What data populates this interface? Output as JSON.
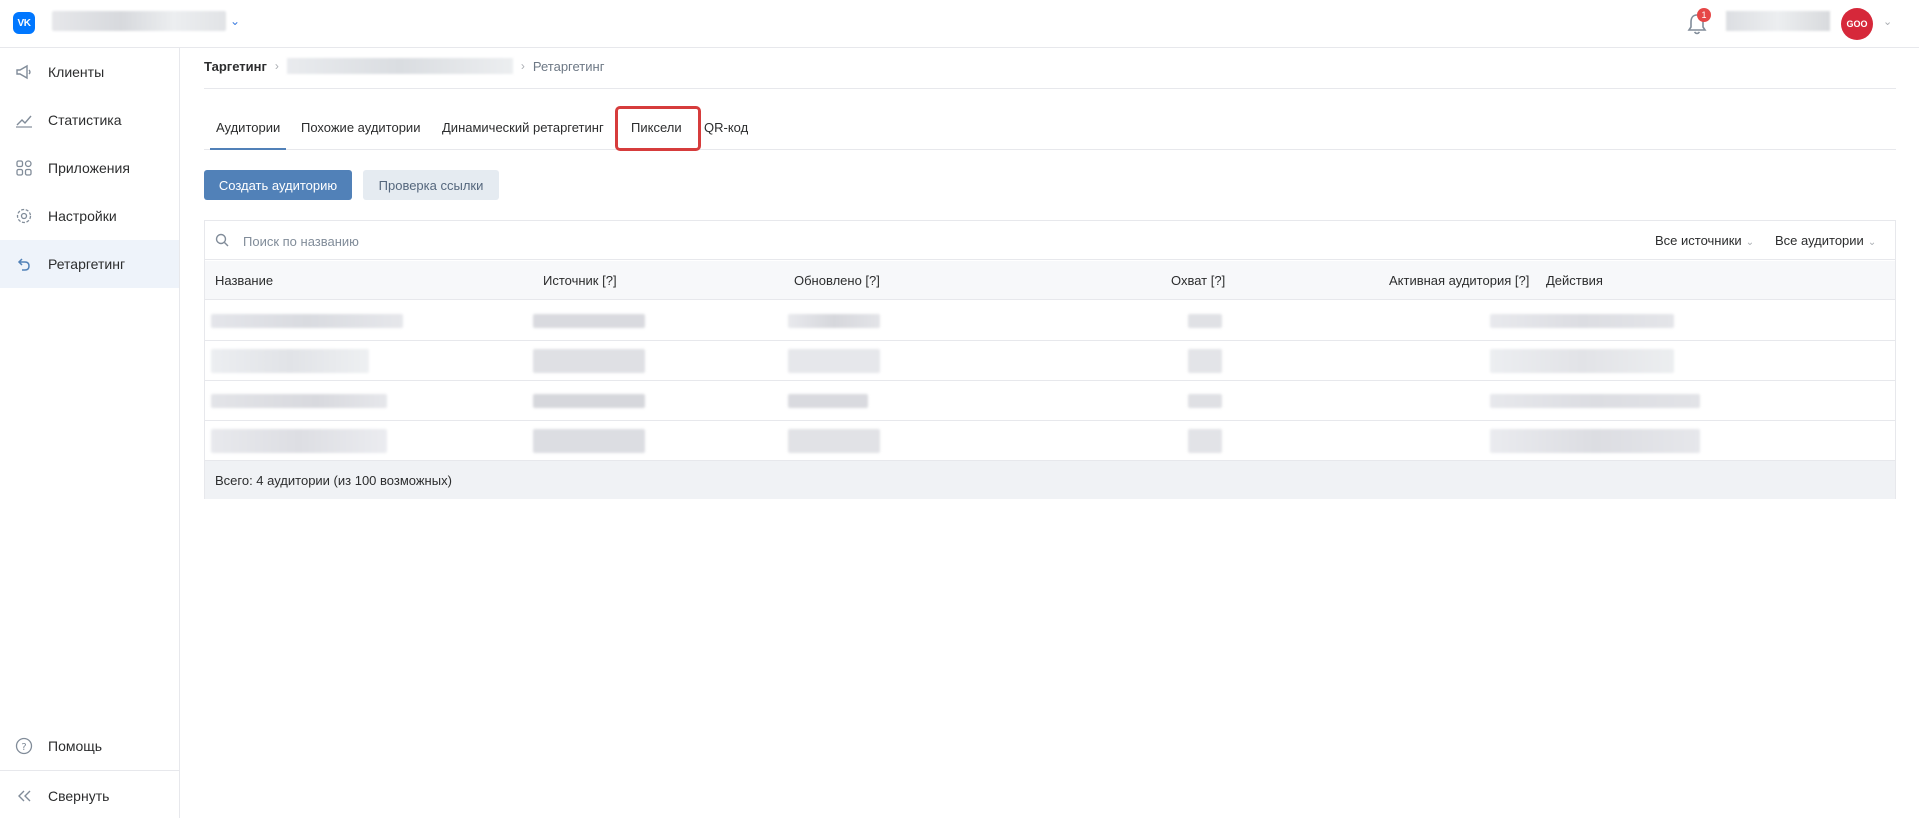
{
  "header": {
    "logo_text": "VK",
    "notification_count": "1",
    "avatar_text": "GOO"
  },
  "sidebar": {
    "items": [
      {
        "label": "Клиенты",
        "icon": "megaphone-icon"
      },
      {
        "label": "Статистика",
        "icon": "chart-line-icon"
      },
      {
        "label": "Приложения",
        "icon": "grid-icon"
      },
      {
        "label": "Настройки",
        "icon": "gear-icon"
      },
      {
        "label": "Ретаргетинг",
        "icon": "retarget-arrow-icon",
        "active": true
      }
    ],
    "help_label": "Помощь",
    "collapse_label": "Свернуть"
  },
  "breadcrumb": {
    "root": "Таргетинг",
    "current": "Ретаргетинг"
  },
  "tabs": [
    {
      "label": "Аудитории",
      "active": true
    },
    {
      "label": "Похожие аудитории"
    },
    {
      "label": "Динамический ретаргетинг"
    },
    {
      "label": "Пиксели",
      "highlighted": true
    },
    {
      "label": "QR-код"
    }
  ],
  "buttons": {
    "create": "Создать аудиторию",
    "check_link": "Проверка ссылки"
  },
  "table": {
    "search_placeholder": "Поиск по названию",
    "filters": {
      "sources": "Все источники",
      "audiences": "Все аудитории"
    },
    "columns": [
      "Название",
      "Источник [?]",
      "Обновлено [?]",
      "Охват [?]",
      "Активная аудитория [?]",
      "Действия"
    ],
    "footer": "Всего: 4 аудитории (из 100 возможных)"
  },
  "colors": {
    "accent": "#5181b8",
    "highlight": "#d63c3c",
    "vk_blue": "#0077ff"
  }
}
